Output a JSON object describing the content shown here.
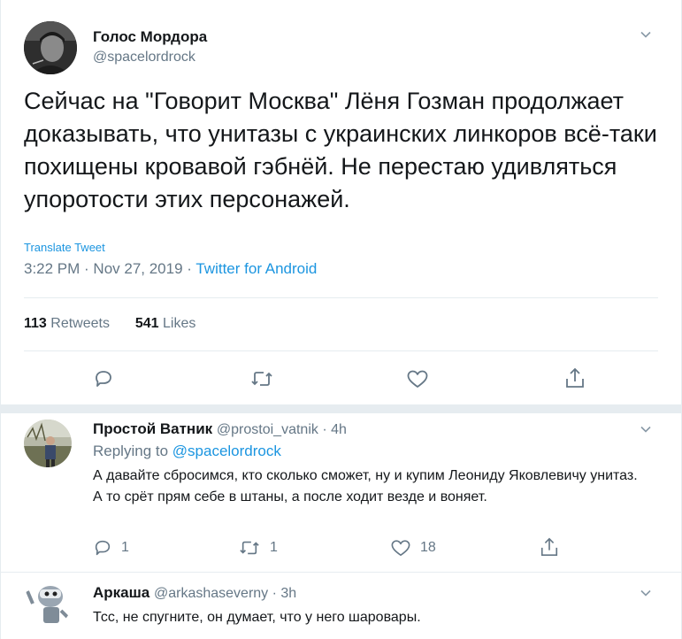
{
  "main_tweet": {
    "author_name": "Голос Мордора",
    "author_handle": "@spacelordrock",
    "text": "Сейчас на \"Говорит Москва\" Лёня Гозман продолжает доказывать, что унитазы с украинских линкоров всё-таки похищены кровавой гэбнёй. Не перестаю удивляться упоротости этих персонажей.",
    "translate_label": "Translate Tweet",
    "time": "3:22 PM · Nov 27, 2019 · ",
    "source": "Twitter for Android",
    "retweets_count": "113",
    "retweets_label": " Retweets",
    "likes_count": "541",
    "likes_label": " Likes"
  },
  "replies": [
    {
      "author_name": "Простой Ватник",
      "author_handle": "@prostoi_vatnik · 4h",
      "replying_label": "Replying to ",
      "replying_handle": "@spacelordrock",
      "text": "А давайте сбросимся, кто сколько сможет, ну и купим Леониду Яковлевичу унитаз. А то срёт прям себе в штаны, а после ходит везде и воняет.",
      "reply_count": "1",
      "retweet_count": "1",
      "like_count": "18"
    },
    {
      "author_name": "Аркаша",
      "author_handle": "@arkashaseverny · 3h",
      "text": "Тсс, не спугните, он думает, что у него шаровары."
    }
  ],
  "icons": [
    "chevron-down-icon",
    "reply-icon",
    "retweet-icon",
    "like-icon",
    "share-icon"
  ],
  "colors": {
    "link": "#1b95e0",
    "muted": "#657786",
    "divider": "#e6ecf0",
    "text": "#14171a"
  }
}
